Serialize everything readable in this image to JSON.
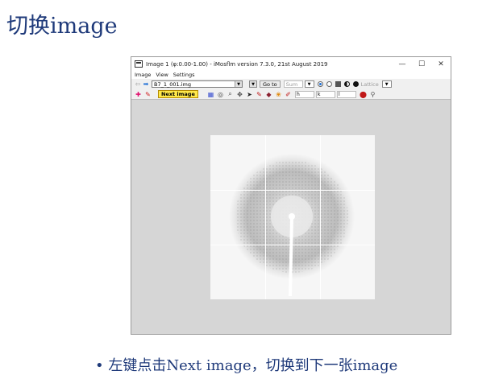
{
  "slide": {
    "title": "切换image",
    "bullet_marker": "•",
    "bullet_text": "左键点击Next image，切换到下一张image"
  },
  "window": {
    "title": "Image 1 (φ:0.00-1.00) - iMosflm version 7.3.0, 21st August 2019",
    "controls": {
      "minimize": "—",
      "maximize": "☐",
      "close": "✕"
    },
    "menu": [
      "Image",
      "View",
      "Settings"
    ],
    "toolbar": {
      "image_file": "B7_1_001.img",
      "goto_label": "Go to",
      "sum_placeholder": "Sum",
      "lattice_label": "Lattice",
      "h_label": "h",
      "k_label": "k",
      "l_label": "l"
    },
    "tooltip": "Next image"
  },
  "colors": {
    "title": "#1f3a7a",
    "tooltip_bg": "#ffe94a",
    "accent": "#1f6fd6"
  }
}
